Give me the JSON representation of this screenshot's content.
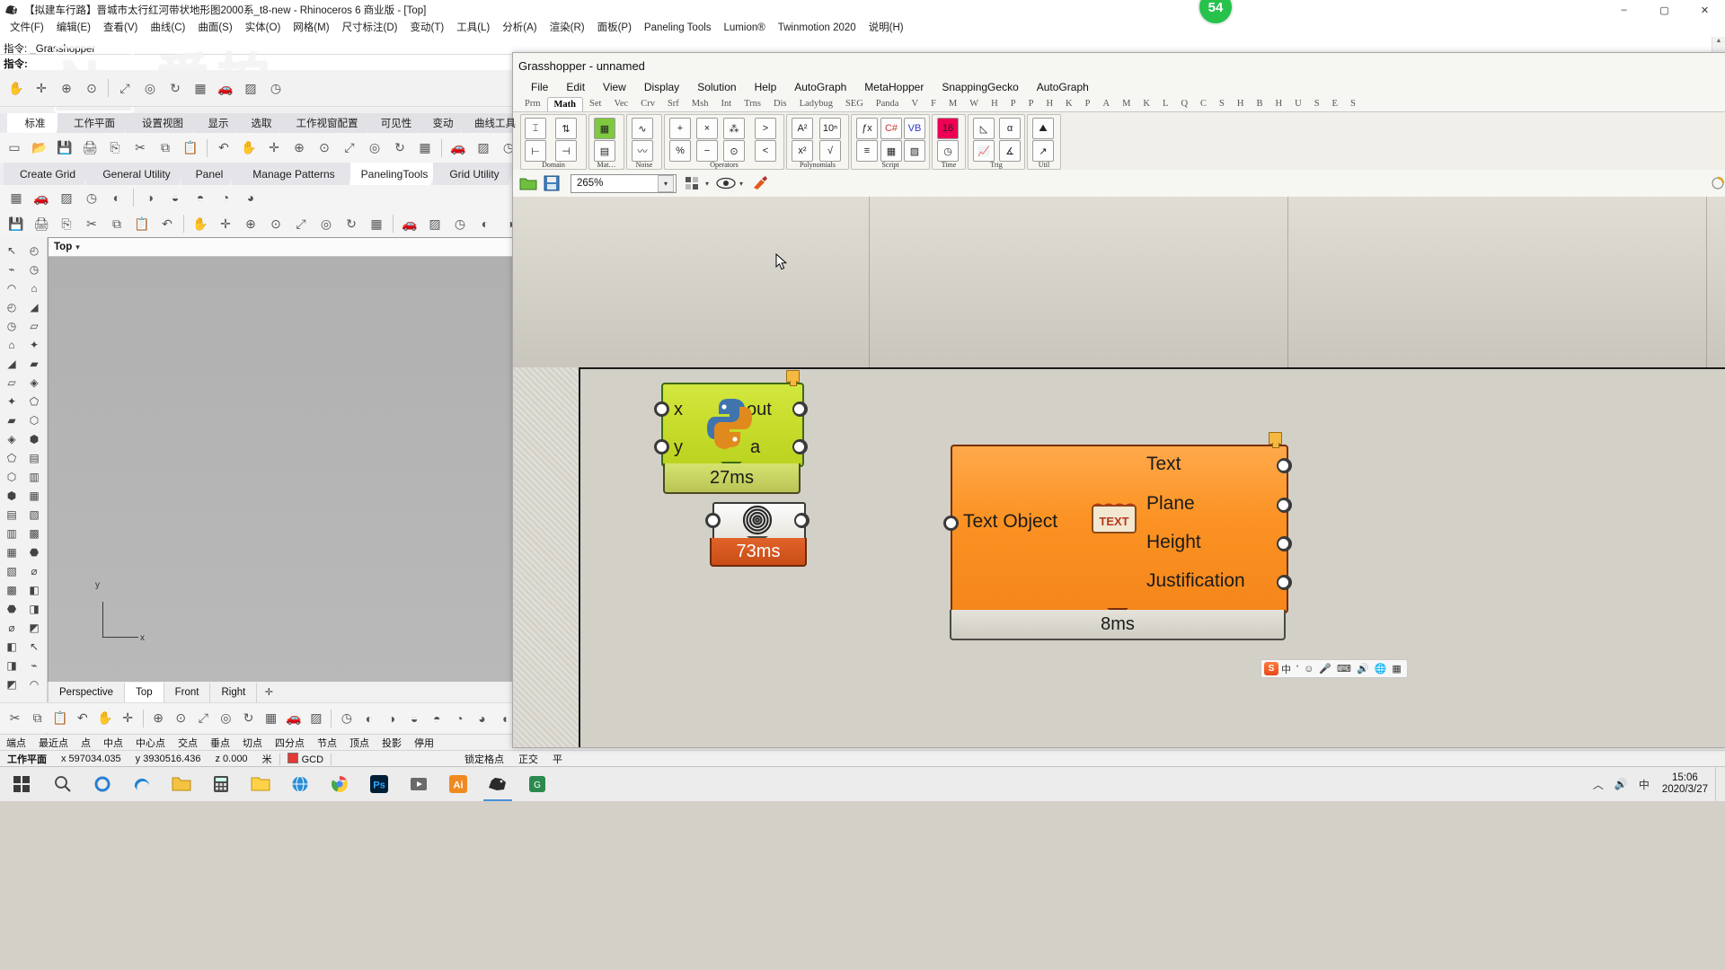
{
  "rhino": {
    "title": "【拟建车行路】晋城市太行红河带状地形图2000系_t8-new - Rhinoceros 6 商业版 - [Top]",
    "window_buttons": [
      "–",
      "▢",
      "✕"
    ],
    "menu": [
      "文件(F)",
      "编辑(E)",
      "查看(V)",
      "曲线(C)",
      "曲面(S)",
      "实体(O)",
      "网格(M)",
      "尺寸标注(D)",
      "变动(T)",
      "工具(L)",
      "分析(A)",
      "渲染(R)",
      "面板(P)",
      "Paneling Tools",
      "Lumion®",
      "Twinmotion 2020",
      "说明(H)"
    ],
    "command_history": "指令: _Grasshopper",
    "command_prompt": "指令:",
    "watermark": "爱拍",
    "tabs_row1": [
      "标准",
      "工作平面",
      "设置视图",
      "显示",
      "选取",
      "工作视窗配置",
      "可见性",
      "变动",
      "曲线工具"
    ],
    "tabs_row1_active": "标准",
    "tabs_row2": [
      "Create Grid",
      "General Utility",
      "Panel",
      "Manage Patterns",
      "PanelingTools",
      "Grid Utility"
    ],
    "tabs_row2_active": "PanelingTools",
    "viewport": {
      "label": "Top",
      "axis_x": "x",
      "axis_y": "y"
    },
    "viewport_tabs": [
      "Perspective",
      "Top",
      "Front",
      "Right"
    ],
    "viewport_tabs_active": "Top",
    "osnap": [
      "端点",
      "最近点",
      "点",
      "中点",
      "中心点",
      "交点",
      "垂点",
      "切点",
      "四分点",
      "节点",
      "顶点",
      "投影",
      "停用"
    ],
    "status": {
      "label": "工作平面",
      "x": "x 597034.035",
      "y": "y 3930516.436",
      "z": "z 0.000",
      "unit": "米",
      "layer": "GCD",
      "grid_lock": "锁定格点",
      "ortho": "正交",
      "planar": "平"
    }
  },
  "grasshopper": {
    "title": "Grasshopper - unnamed",
    "menu": [
      "File",
      "Edit",
      "View",
      "Display",
      "Solution",
      "Help",
      "AutoGraph",
      "MetaHopper",
      "SnappingGecko",
      "AutoGraph"
    ],
    "tabs": [
      "Prm",
      "Math",
      "Set",
      "Vec",
      "Crv",
      "Srf",
      "Msh",
      "Int",
      "Trns",
      "Dis",
      "Ladybug",
      "SEG",
      "Panda",
      "V",
      "F",
      "M",
      "W",
      "H",
      "P",
      "P",
      "H",
      "K",
      "P",
      "A",
      "M",
      "K",
      "L",
      "Q",
      "C",
      "S",
      "H",
      "B",
      "H",
      "U",
      "S",
      "E",
      "S"
    ],
    "tabs_active": "Math",
    "ribbon_groups": [
      {
        "label": "Domain"
      },
      {
        "label": "Mat…"
      },
      {
        "label": "Noise"
      },
      {
        "label": "Operators"
      },
      {
        "label": "Polynomials"
      },
      {
        "label": "Script"
      },
      {
        "label": "Time"
      },
      {
        "label": "Trig"
      },
      {
        "label": "Util"
      }
    ],
    "zoom": "265%",
    "canvas": {
      "python_component": {
        "inputs": [
          "x",
          "y"
        ],
        "outputs": [
          "out",
          "a"
        ],
        "timer": "27ms"
      },
      "slider_component": {
        "timer": "73ms"
      },
      "text_component": {
        "input": "Text Object",
        "outputs": [
          "Text",
          "Plane",
          "Height",
          "Justification"
        ],
        "timer": "8ms"
      }
    },
    "ime": {
      "logo": "S",
      "items": [
        "中",
        "'",
        "☺",
        "🎤",
        "⌨",
        "🔊",
        "🌐",
        "▦"
      ]
    }
  },
  "taskbar": {
    "badge": "54",
    "clock_time": "15:06",
    "clock_date": "2020/3/27",
    "tray": [
      "︿",
      "🔊",
      "中"
    ],
    "items": [
      "start",
      "search",
      "edge",
      "explorer",
      "calc",
      "folder",
      "browser",
      "chrome",
      "photoshop",
      "rhino",
      "illustrator",
      "app",
      "ps2",
      "ai2"
    ]
  }
}
